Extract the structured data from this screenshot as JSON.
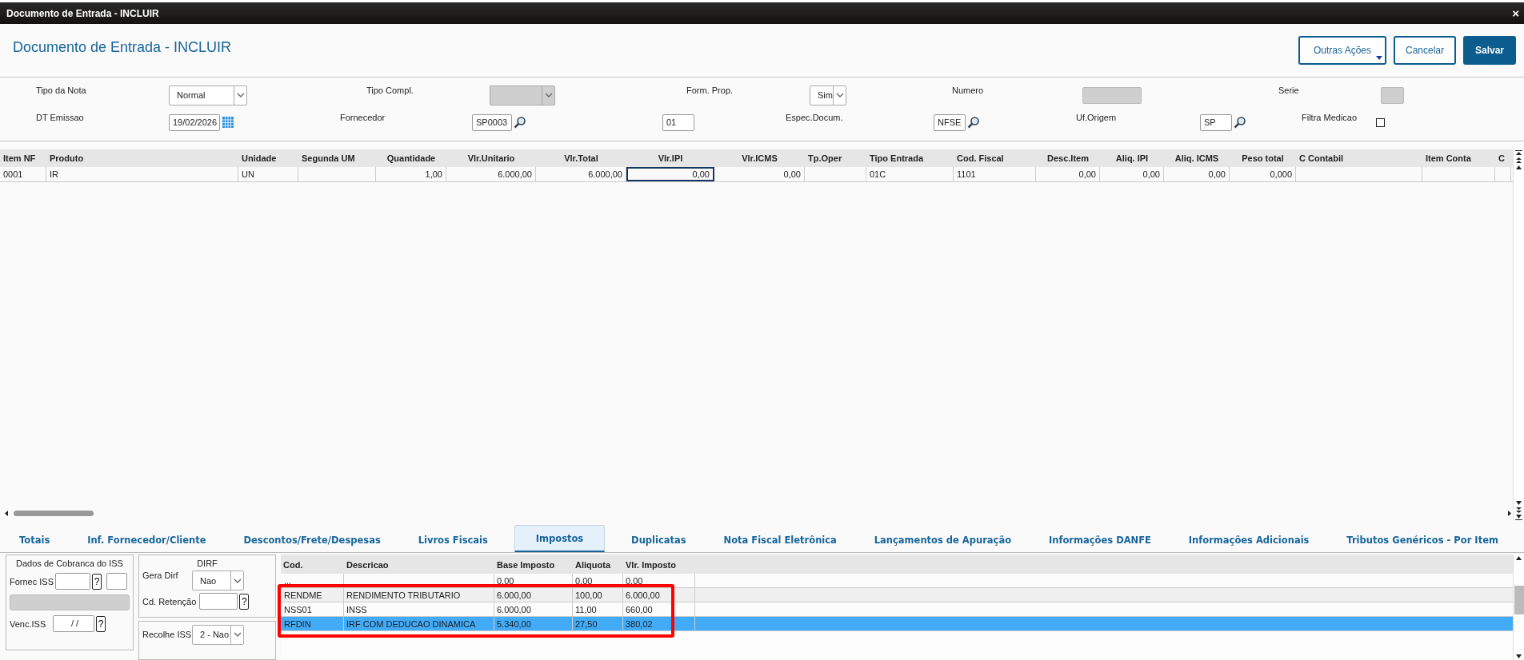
{
  "window": {
    "title": "Documento de Entrada - INCLUIR",
    "close": "×"
  },
  "header": {
    "title": "Documento de Entrada - INCLUIR",
    "actions": [
      {
        "label": "Outras Ações",
        "kind": "menu"
      },
      {
        "label": "Cancelar",
        "kind": "secondary"
      },
      {
        "label": "Salvar",
        "kind": "primary"
      }
    ]
  },
  "form": {
    "rows": [
      [
        {
          "kind": "label",
          "text": "Tipo da Nota"
        },
        {
          "kind": "select",
          "value": "Normal",
          "disabled": false
        },
        {
          "kind": "label",
          "text": "Tipo Compl."
        },
        {
          "kind": "select",
          "disabled": true
        },
        {
          "kind": "label",
          "text": "Form. Prop."
        },
        {
          "kind": "select",
          "value": "Sim",
          "disabled": false
        },
        {
          "kind": "label",
          "text": "Numero"
        },
        {
          "kind": "field",
          "disabled": true
        },
        {
          "kind": "label",
          "text": "Serie"
        },
        {
          "kind": "field",
          "disabled": true
        }
      ],
      [
        {
          "kind": "label",
          "text": "DT Emissao"
        },
        {
          "kind": "date",
          "value": "19/02/2026",
          "disabled": false
        },
        {
          "kind": "label",
          "text": "Fornecedor"
        },
        {
          "kind": "lookup",
          "value": "SP0003",
          "disabled": false
        },
        {
          "kind": "field",
          "value": "01",
          "disabled": false
        },
        {
          "kind": "label",
          "text": "Espec.Docum."
        },
        {
          "kind": "lookup",
          "value": "NFSE",
          "disabled": false
        },
        {
          "kind": "label",
          "text": "Uf.Origem"
        },
        {
          "kind": "lookup",
          "value": "SP",
          "disabled": false
        },
        {
          "kind": "label",
          "text": "Filtra Medicao"
        },
        {
          "kind": "checkbox",
          "checked": false
        }
      ]
    ]
  },
  "items_table": {
    "columns": [
      {
        "label": "Item NF",
        "numeric": false
      },
      {
        "label": "Produto",
        "numeric": false
      },
      {
        "label": "Unidade",
        "numeric": false
      },
      {
        "label": "Segunda UM",
        "numeric": false
      },
      {
        "label": "Quantidade",
        "numeric": true
      },
      {
        "label": "Vlr.Unitario",
        "numeric": true
      },
      {
        "label": "Vlr.Total",
        "numeric": true
      },
      {
        "label": "Vlr.IPI",
        "numeric": true
      },
      {
        "label": "Vlr.ICMS",
        "numeric": true
      },
      {
        "label": "Tp.Oper",
        "numeric": false
      },
      {
        "label": "Tipo Entrada",
        "numeric": false
      },
      {
        "label": "Cod. Fiscal",
        "numeric": false
      },
      {
        "label": "Desc.Item",
        "numeric": true
      },
      {
        "label": "Aliq. IPI",
        "numeric": true
      },
      {
        "label": "Aliq. ICMS",
        "numeric": true
      },
      {
        "label": "Peso total",
        "numeric": true
      },
      {
        "label": "C Contabil",
        "numeric": false
      },
      {
        "label": "Item Conta",
        "numeric": false
      },
      {
        "label": "C",
        "numeric": false
      }
    ],
    "rows": [
      {
        "cells": [
          {
            "text": "0001",
            "focused": false
          },
          {
            "text": "IR",
            "focused": false
          },
          {
            "text": "UN",
            "focused": false
          },
          {
            "text": "",
            "focused": false
          },
          {
            "text": "1,00",
            "focused": false
          },
          {
            "text": "6.000,00",
            "focused": false
          },
          {
            "text": "6.000,00",
            "focused": false
          },
          {
            "text": "0,00",
            "focused": true
          },
          {
            "text": "0,00",
            "focused": false
          },
          {
            "text": "",
            "focused": false
          },
          {
            "text": "01C",
            "focused": false
          },
          {
            "text": "1101",
            "focused": false
          },
          {
            "text": "0,00",
            "focused": false
          },
          {
            "text": "0,00",
            "focused": false
          },
          {
            "text": "0,00",
            "focused": false
          },
          {
            "text": "0,000",
            "focused": false
          },
          {
            "text": "",
            "focused": false
          },
          {
            "text": "",
            "focused": false
          },
          {
            "text": "",
            "focused": false
          }
        ]
      }
    ]
  },
  "tabs": [
    {
      "label": "Totais",
      "selected": false
    },
    {
      "label": "Inf. Fornecedor/Cliente",
      "selected": false
    },
    {
      "label": "Descontos/Frete/Despesas",
      "selected": false
    },
    {
      "label": "Livros Fiscais",
      "selected": false
    },
    {
      "label": "Impostos",
      "selected": true
    },
    {
      "label": "Duplicatas",
      "selected": false
    },
    {
      "label": "Nota Fiscal Eletrônica",
      "selected": false
    },
    {
      "label": "Lançamentos de Apuração",
      "selected": false
    },
    {
      "label": "Informações DANFE",
      "selected": false
    },
    {
      "label": "Informações Adicionais",
      "selected": false
    },
    {
      "label": "Tributos Genéricos - Por Item",
      "selected": false
    }
  ],
  "iss_panel": {
    "title": "Dados de Cobranca do ISS",
    "fornec_label": "Fornec ISS",
    "help": "?",
    "venc_label": "Venc.ISS",
    "venc_value": " / /",
    "venc_help": "?"
  },
  "dirf_panel": {
    "title": "DIRF",
    "gera_label": "Gera Dirf",
    "gera_value": "Nao",
    "retencao_label": "Cd. Retenção",
    "retencao_help": "?",
    "recolhe_label": "Recolhe ISS",
    "recolhe_value": "2 - Nao"
  },
  "tax_table": {
    "columns": [
      "Cod.",
      "Descricao",
      "Base Imposto",
      "Aliquota",
      "Vlr. Imposto"
    ],
    "rows": [
      {
        "cells": [
          "...",
          "",
          "0,00",
          "0,00",
          "0,00"
        ],
        "selected": false,
        "highlighted": false
      },
      {
        "cells": [
          "RENDME",
          "RENDIMENTO TRIBUTARIO",
          "6.000,00",
          "100,00",
          "6.000,00"
        ],
        "selected": false,
        "highlighted": true
      },
      {
        "cells": [
          "NSS01",
          "INSS",
          "6.000,00",
          "11,00",
          "660,00"
        ],
        "selected": false,
        "highlighted": true
      },
      {
        "cells": [
          "RFDIN",
          "IRF COM DEDUCAO DINAMICA",
          "5.340,00",
          "27,50",
          "380,02"
        ],
        "selected": true,
        "highlighted": true
      }
    ]
  }
}
